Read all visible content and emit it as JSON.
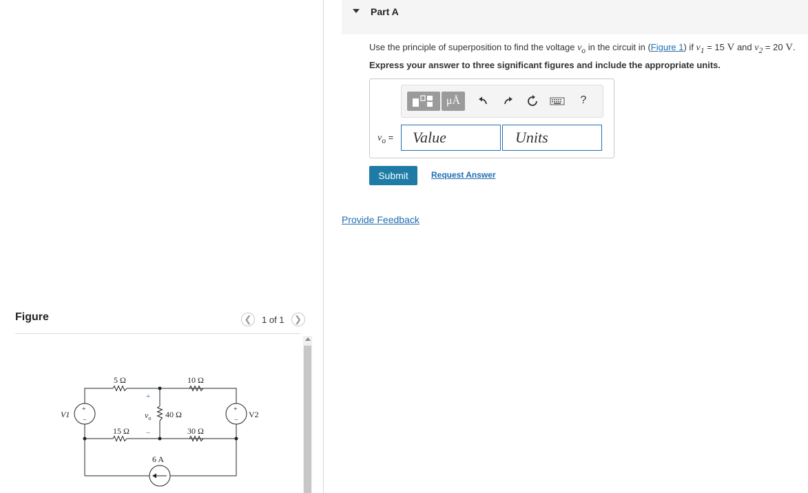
{
  "part": {
    "title": "Part A"
  },
  "question": {
    "intro": "Use the principle of superposition to find the voltage ",
    "var": "v",
    "var_sub": "o",
    "mid": " in the circuit in (",
    "figure_link": "Figure 1",
    "cond_pre": ") if ",
    "v1_var": "v",
    "v1_sub": "1",
    "v1_eq": " = 15 ",
    "v1_unit": "V",
    "and": " and ",
    "v2_var": "v",
    "v2_sub": "2",
    "v2_eq": " = 20 ",
    "v2_unit": "V",
    "end": "."
  },
  "instruction": "Express your answer to three significant figures and include the appropriate units.",
  "toolbar": {
    "units_glyph": "μÅ",
    "help": "?",
    "icons": [
      "templates-icon",
      "units-icon",
      "undo-icon",
      "redo-icon",
      "reset-icon",
      "keyboard-icon",
      "help-icon"
    ]
  },
  "answer": {
    "label_var": "v",
    "label_sub": "o",
    "label_eq": " =",
    "value_placeholder": "Value",
    "units_placeholder": "Units"
  },
  "buttons": {
    "submit": "Submit",
    "request_answer": "Request Answer"
  },
  "feedback": "Provide Feedback",
  "figure": {
    "title": "Figure",
    "page_indicator": "1 of 1",
    "circuit": {
      "r1": "5 Ω",
      "r2": "10 Ω",
      "r3": "15 Ω",
      "r4": "30 Ω",
      "r5": "40 Ω",
      "source_v1": "V1",
      "source_v2": "V2",
      "current_source": "6 A",
      "plus": "+",
      "minus": "−",
      "vo": "v",
      "vo_sub": "o"
    }
  },
  "colors": {
    "accent": "#1d7ba6",
    "link": "#1f6db0",
    "input_border": "#1f6db0",
    "toolbar_btn": "#9b9b9b"
  }
}
